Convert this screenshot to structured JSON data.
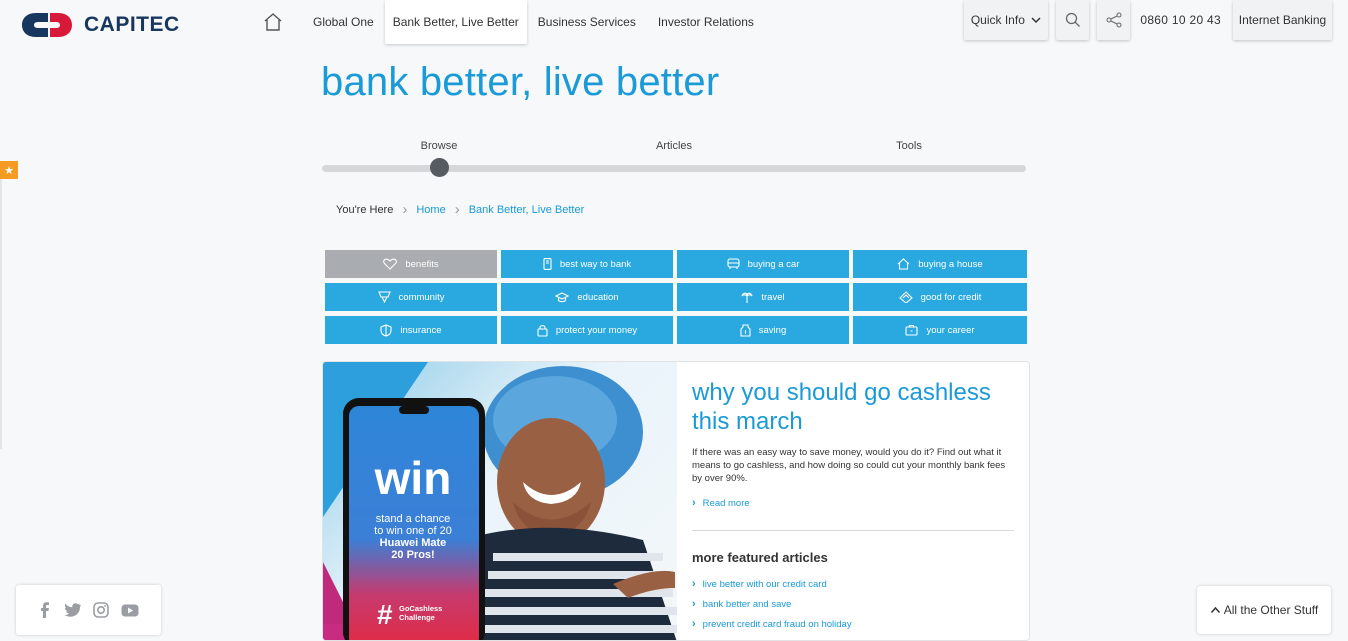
{
  "brand": {
    "name": "CAPITEC"
  },
  "nav": {
    "home_icon": "home-icon",
    "items": [
      {
        "label": "Global One"
      },
      {
        "label": "Bank Better, Live Better",
        "active": true
      },
      {
        "label": "Business Services"
      },
      {
        "label": "Investor Relations"
      }
    ]
  },
  "toolbar": {
    "quick_info": "Quick Info",
    "search_icon": "search-icon",
    "share_icon": "share-icon",
    "phone": "0860 10 20 43",
    "internet_banking": "Internet Banking"
  },
  "page": {
    "title": "bank better, live better"
  },
  "steps": {
    "items": [
      "Browse",
      "Articles",
      "Tools"
    ],
    "current": "Browse"
  },
  "breadcrumb": {
    "prefix": "You're Here",
    "items": [
      "Home",
      "Bank Better, Live Better"
    ]
  },
  "categories": [
    {
      "label": "benefits",
      "icon": "heart-handshake-icon",
      "active": true
    },
    {
      "label": "best way to bank",
      "icon": "phone-icon"
    },
    {
      "label": "buying a car",
      "icon": "car-icon"
    },
    {
      "label": "buying a house",
      "icon": "house-icon"
    },
    {
      "label": "community",
      "icon": "community-icon"
    },
    {
      "label": "education",
      "icon": "graduation-cap-icon"
    },
    {
      "label": "travel",
      "icon": "palm-tree-icon"
    },
    {
      "label": "good for credit",
      "icon": "credit-card-icon"
    },
    {
      "label": "insurance",
      "icon": "shield-icon"
    },
    {
      "label": "protect your money",
      "icon": "lock-icon"
    },
    {
      "label": "saving",
      "icon": "jar-icon"
    },
    {
      "label": "your career",
      "icon": "briefcase-icon"
    }
  ],
  "featured": {
    "image": {
      "headline": "win",
      "line1": "stand a chance",
      "line2": "to win one of 20",
      "line3": "Huawei Mate",
      "line4": "20 Pros!",
      "hashtag_symbol": "#",
      "hashtag_line1": "GoCashless",
      "hashtag_line2": "Challenge"
    },
    "title": "why you should go cashless this march",
    "body": "If there was an easy way to save money, would you do it? Find out what it means to go cashless, and how doing so could cut your monthly bank fees by over 90%.",
    "read_more": "Read more"
  },
  "more_articles": {
    "title": "more featured articles",
    "items": [
      "live better with our credit card",
      "bank better and save",
      "prevent credit card fraud on holiday"
    ]
  },
  "social": {
    "icons": [
      "facebook-icon",
      "twitter-icon",
      "instagram-icon",
      "youtube-icon"
    ]
  },
  "footer_tab": {
    "label": "All the Other Stuff"
  },
  "colors": {
    "accent_blue": "#1a9ad6",
    "tile_blue": "#2aa9e0",
    "tile_active": "#a9acb0",
    "brand_navy": "#17375e",
    "brand_red": "#d7193a",
    "star_orange": "#f59b23"
  }
}
